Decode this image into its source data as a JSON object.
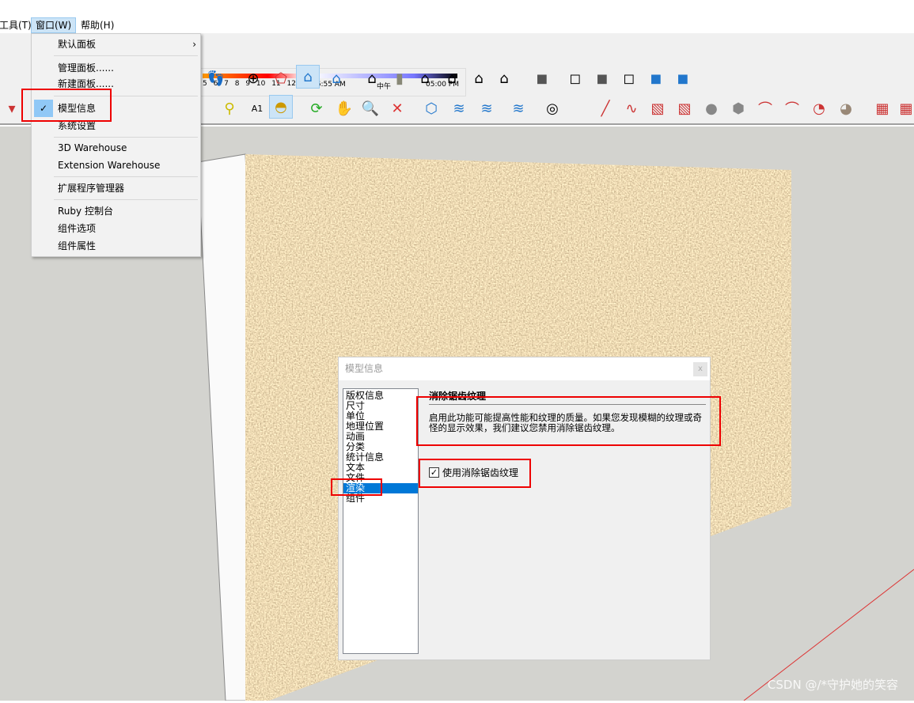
{
  "menubar": {
    "items": [
      "工具(T)",
      "窗口(W)",
      "帮助(H)"
    ]
  },
  "shadow": {
    "hours": [
      "5",
      "6",
      "7",
      "8",
      "9",
      "10",
      "11",
      "12"
    ],
    "time_start": "06:55 AM",
    "time_mid": "中午",
    "time_end": "05:00 PM"
  },
  "window_menu": {
    "items": [
      {
        "label": "默认面板",
        "submenu": true
      },
      {
        "label": "管理面板......"
      },
      {
        "label": "新建面板......"
      },
      {
        "label": "模型信息",
        "checked": true
      },
      {
        "label": "系统设置"
      },
      {
        "label": "3D Warehouse"
      },
      {
        "label": "Extension Warehouse"
      },
      {
        "label": "扩展程序管理器"
      },
      {
        "label": "Ruby 控制台"
      },
      {
        "label": "组件选项"
      },
      {
        "label": "组件属性"
      }
    ],
    "submenu_arrow": "›",
    "check": "✓"
  },
  "dialog": {
    "title": "模型信息",
    "close": "x",
    "list": [
      "版权信息",
      "尺寸",
      "单位",
      "地理位置",
      "动画",
      "分类",
      "统计信息",
      "文本",
      "文件",
      "渲染",
      "组件"
    ],
    "selected": "渲染",
    "heading": "消除锯齿纹理",
    "description": "启用此功能可能提高性能和纹理的质量。如果您发现模糊的纹理或奇怪的显示效果，我们建议您禁用消除锯齿纹理。",
    "checkbox_label": "使用消除锯齿纹理",
    "checkbox_checked": true
  },
  "watermark": "CSDN @/*守护她的笑容",
  "colors": {
    "highlight": "#0078d7",
    "annotation": "#e00000",
    "menu_active": "#cce4f7"
  }
}
